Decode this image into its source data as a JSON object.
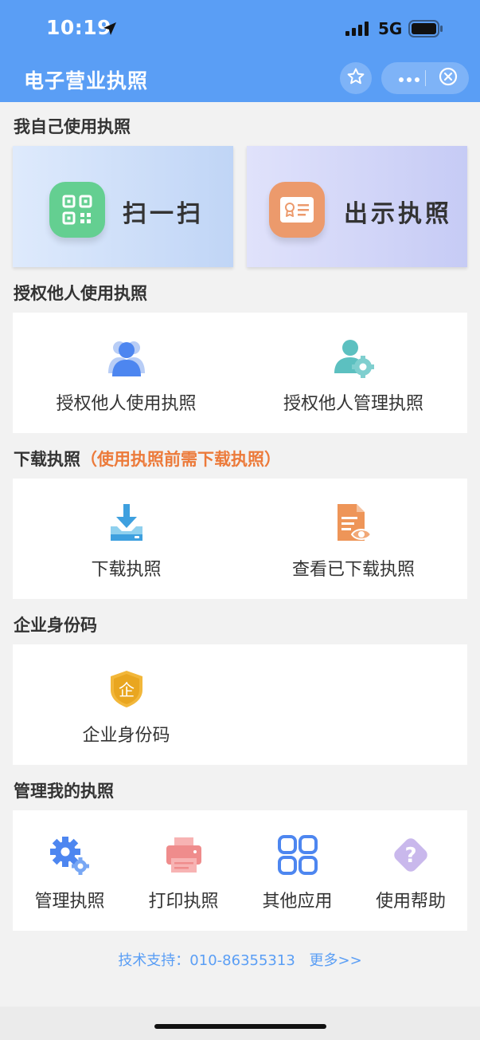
{
  "status_bar": {
    "time": "10:19",
    "network": "5G"
  },
  "nav": {
    "title": "电子营业执照"
  },
  "sections": {
    "self_use": "我自己使用执照",
    "authorize": "授权他人使用执照",
    "download": "下载执照",
    "download_note": "（使用执照前需下载执照）",
    "enterprise_id": "企业身份码",
    "manage": "管理我的执照"
  },
  "cards": {
    "scan": "扫一扫",
    "show": "出示执照"
  },
  "authorize_items": [
    "授权他人使用执照",
    "授权他人管理执照"
  ],
  "download_items": [
    "下载执照",
    "查看已下载执照"
  ],
  "enterprise_items": [
    "企业身份码"
  ],
  "manage_items": [
    "管理执照",
    "打印执照",
    "其他应用",
    "使用帮助"
  ],
  "footer": {
    "support": "技术支持：010-86355313",
    "more": "更多>>"
  },
  "colors": {
    "header": "#5a9ef5",
    "accent_orange": "#ec7a3a",
    "scan_green": "#64cf91",
    "show_orange": "#ec9a6c"
  }
}
